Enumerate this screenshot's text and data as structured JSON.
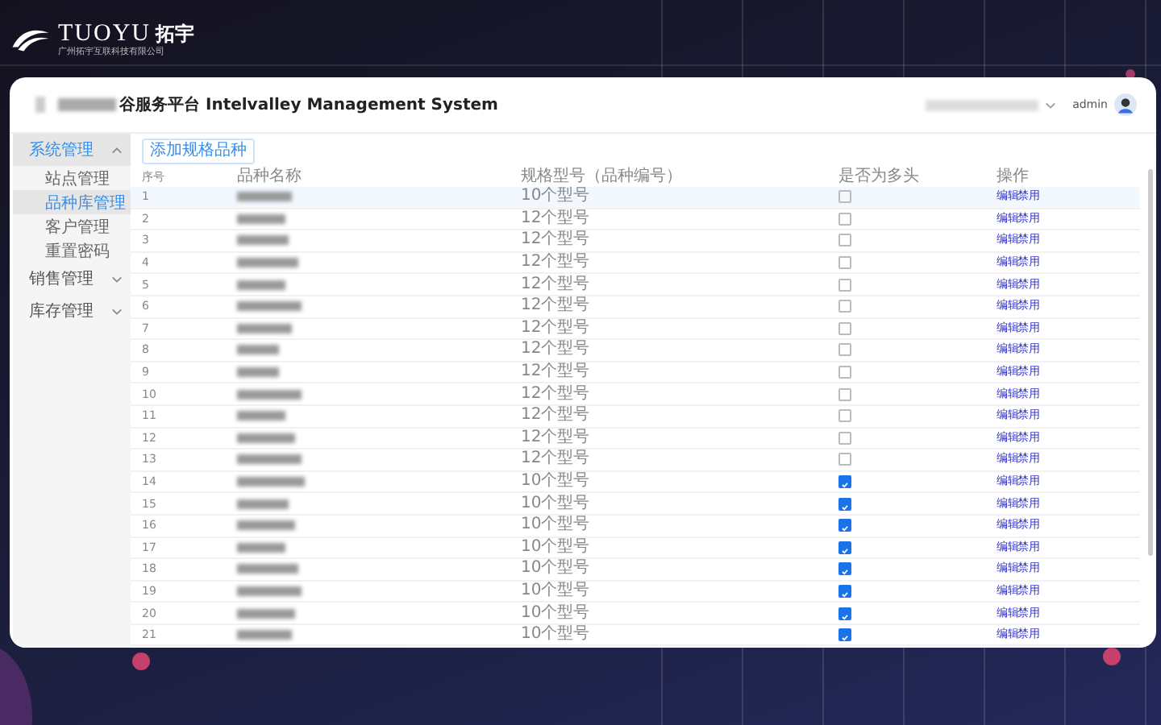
{
  "logo": {
    "brand": "TUOYU",
    "brand_cn": "拓宇",
    "company": "广州拓宇互联科技有限公司"
  },
  "header": {
    "title": "谷服务平台 Intelvalley Management System",
    "user": "admin"
  },
  "sidebar": {
    "items": [
      {
        "label": "系统管理",
        "selected": true,
        "expanded": true,
        "children": [
          {
            "label": "站点管理",
            "selected": false
          },
          {
            "label": "品种库管理",
            "selected": true
          },
          {
            "label": "客户管理",
            "selected": false
          },
          {
            "label": "重置密码",
            "selected": false
          }
        ]
      },
      {
        "label": "销售管理",
        "selected": false,
        "expanded": false
      },
      {
        "label": "库存管理",
        "selected": false,
        "expanded": false
      }
    ]
  },
  "toolbar": {
    "add_button": "添加规格品种"
  },
  "table": {
    "columns": [
      "序号",
      "品种名称",
      "规格型号（品种编号）",
      "是否为多头",
      "操作"
    ],
    "rows": [
      {
        "no": "1",
        "spec": "10个型号",
        "checked": false,
        "actions": [
          "编辑",
          "禁用"
        ],
        "selected": true
      },
      {
        "no": "2",
        "spec": "12个型号",
        "checked": false,
        "actions": [
          "编辑",
          "禁用"
        ],
        "selected": false
      },
      {
        "no": "3",
        "spec": "12个型号",
        "checked": false,
        "actions": [
          "编辑",
          "禁用"
        ],
        "selected": false
      },
      {
        "no": "4",
        "spec": "12个型号",
        "checked": false,
        "actions": [
          "编辑",
          "禁用"
        ],
        "selected": false
      },
      {
        "no": "5",
        "spec": "12个型号",
        "checked": false,
        "actions": [
          "编辑",
          "禁用"
        ],
        "selected": false
      },
      {
        "no": "6",
        "spec": "12个型号",
        "checked": false,
        "actions": [
          "编辑",
          "禁用"
        ],
        "selected": false
      },
      {
        "no": "7",
        "spec": "12个型号",
        "checked": false,
        "actions": [
          "编辑",
          "禁用"
        ],
        "selected": false
      },
      {
        "no": "8",
        "spec": "12个型号",
        "checked": false,
        "actions": [
          "编辑",
          "禁用"
        ],
        "selected": false
      },
      {
        "no": "9",
        "spec": "12个型号",
        "checked": false,
        "actions": [
          "编辑",
          "禁用"
        ],
        "selected": false
      },
      {
        "no": "10",
        "spec": "12个型号",
        "checked": false,
        "actions": [
          "编辑",
          "禁用"
        ],
        "selected": false
      },
      {
        "no": "11",
        "spec": "12个型号",
        "checked": false,
        "actions": [
          "编辑",
          "禁用"
        ],
        "selected": false
      },
      {
        "no": "12",
        "spec": "12个型号",
        "checked": false,
        "actions": [
          "编辑",
          "禁用"
        ],
        "selected": false
      },
      {
        "no": "13",
        "spec": "12个型号",
        "checked": false,
        "actions": [
          "编辑",
          "禁用"
        ],
        "selected": false
      },
      {
        "no": "14",
        "spec": "10个型号",
        "checked": true,
        "actions": [
          "编辑",
          "禁用"
        ],
        "selected": false
      },
      {
        "no": "15",
        "spec": "10个型号",
        "checked": true,
        "actions": [
          "编辑",
          "禁用"
        ],
        "selected": false
      },
      {
        "no": "16",
        "spec": "10个型号",
        "checked": true,
        "actions": [
          "编辑",
          "禁用"
        ],
        "selected": false
      },
      {
        "no": "17",
        "spec": "10个型号",
        "checked": true,
        "actions": [
          "编辑",
          "禁用"
        ],
        "selected": false
      },
      {
        "no": "18",
        "spec": "10个型号",
        "checked": true,
        "actions": [
          "编辑",
          "禁用"
        ],
        "selected": false
      },
      {
        "no": "19",
        "spec": "10个型号",
        "checked": true,
        "actions": [
          "编辑",
          "禁用"
        ],
        "selected": false
      },
      {
        "no": "20",
        "spec": "10个型号",
        "checked": true,
        "actions": [
          "编辑",
          "禁用"
        ],
        "selected": false
      },
      {
        "no": "21",
        "spec": "10个型号",
        "checked": true,
        "actions": [
          "编辑",
          "禁用"
        ],
        "selected": false
      }
    ]
  }
}
